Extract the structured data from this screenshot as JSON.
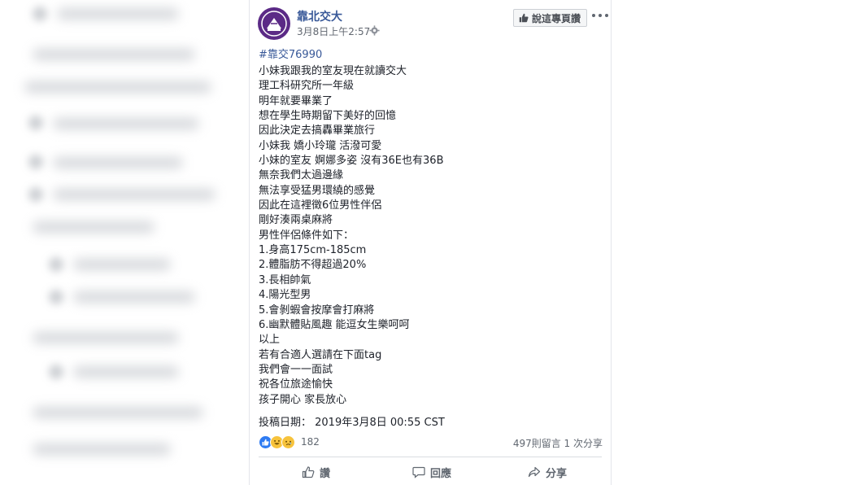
{
  "post": {
    "page_name": "靠北交大",
    "timestamp": "3月8日上午2:57 ·",
    "like_page_label": "說這專頁讚",
    "hashtag": "#靠交76990",
    "body_lines": [
      "小妹我跟我的室友現在就讀交大",
      "理工科研究所一年級",
      "明年就要畢業了",
      "想在學生時期留下美好的回憶",
      "因此決定去搞轟畢業旅行",
      "小妹我 嬌小玲瓏 活潑可愛",
      "小妹的室友 婀娜多姿 沒有36E也有36B",
      "無奈我們太過邊緣",
      "無法享受猛男環繞的感覺",
      "因此在這裡徵6位男性伴侶",
      "剛好湊兩桌麻將",
      "男性伴侶條件如下：",
      "1.身高175cm-185cm",
      "2.體脂肪不得超過20%",
      "3.長相帥氣",
      "4.陽光型男",
      "5.會剝蝦會按摩會打麻將",
      "6.幽默體貼風趣 能逗女生樂呵呵",
      "以上",
      "若有合適人選請在下面tag",
      "我們會一一面試",
      "祝各位旅途愉快",
      "孩子開心 家長放心"
    ],
    "post_date": "投稿日期： 2019年3月8日 00:55 CST",
    "reactions": {
      "icons": [
        "like-icon",
        "haha-icon",
        "sad-icon"
      ],
      "count": "182"
    },
    "stats": "497則留言 1 次分享",
    "actions": {
      "like": "讚",
      "comment": "回應",
      "share": "分享"
    }
  },
  "colors": {
    "link": "#385898",
    "secondary_text": "#606770",
    "logo_purple": "#5b2a86",
    "like_blue": "#2e7bf2"
  }
}
